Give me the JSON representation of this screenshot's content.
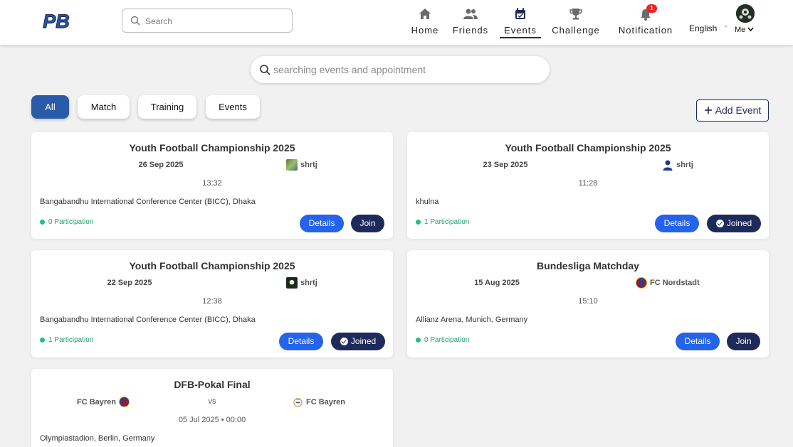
{
  "header": {
    "logo_text": "PB",
    "search_placeholder": "Search",
    "nav": [
      {
        "label": "Home",
        "icon": "home-icon"
      },
      {
        "label": "Friends",
        "icon": "friends-icon"
      },
      {
        "label": "Events",
        "icon": "calendar-icon",
        "active": true
      },
      {
        "label": "Challenge",
        "icon": "trophy-icon"
      },
      {
        "label": "Notification",
        "icon": "bell-icon",
        "badge": "1"
      }
    ],
    "language": "English",
    "me_label": "Me"
  },
  "event_search": {
    "placeholder": "searching events and appointment"
  },
  "tabs": [
    {
      "label": "All",
      "active": true
    },
    {
      "label": "Match"
    },
    {
      "label": "Training"
    },
    {
      "label": "Events"
    }
  ],
  "add_event_label": "Add Event",
  "cards": [
    {
      "title": "Youth Football Championship 2025",
      "date": "26 Sep 2025",
      "organizer": "shrtj",
      "time": "13:32",
      "location": "Bangabandhu International Conference Center (BICC), Dhaka",
      "participation": "0 Participation",
      "details_label": "Details",
      "action_label": "Join"
    },
    {
      "title": "Youth Football Championship 2025",
      "date": "23 Sep 2025",
      "organizer": "shrtj",
      "time": "11:28",
      "location": "khulna",
      "participation": "1 Participation",
      "details_label": "Details",
      "action_label": "Joined"
    },
    {
      "title": "Youth Football Championship 2025",
      "date": "22 Sep 2025",
      "organizer": "shrtj",
      "time": "12:38",
      "location": "Bangabandhu International Conference Center (BICC), Dhaka",
      "participation": "1 Participation",
      "details_label": "Details",
      "action_label": "Joined"
    },
    {
      "title": "Bundesliga Matchday",
      "date": "15 Aug 2025",
      "organizer": "FC Nordstadt",
      "time": "15:10",
      "location": "Allianz Arena, Munich, Germany",
      "participation": "0 Participation",
      "details_label": "Details",
      "action_label": "Join"
    },
    {
      "title": "DFB-Pokal Final",
      "team_home": "FC Bayren",
      "vs": "vs",
      "team_away": "FC Bayren",
      "datetime": "05 Jul 2025 • 00:00",
      "location": "Olympiastadion, Berlin, Germany"
    }
  ],
  "colors": {
    "primary_navy": "#1e2a5a",
    "details_blue": "#2563eb",
    "tab_active": "#2a5ba8",
    "participation_green": "#22a06b",
    "badge_red": "#e22222"
  }
}
